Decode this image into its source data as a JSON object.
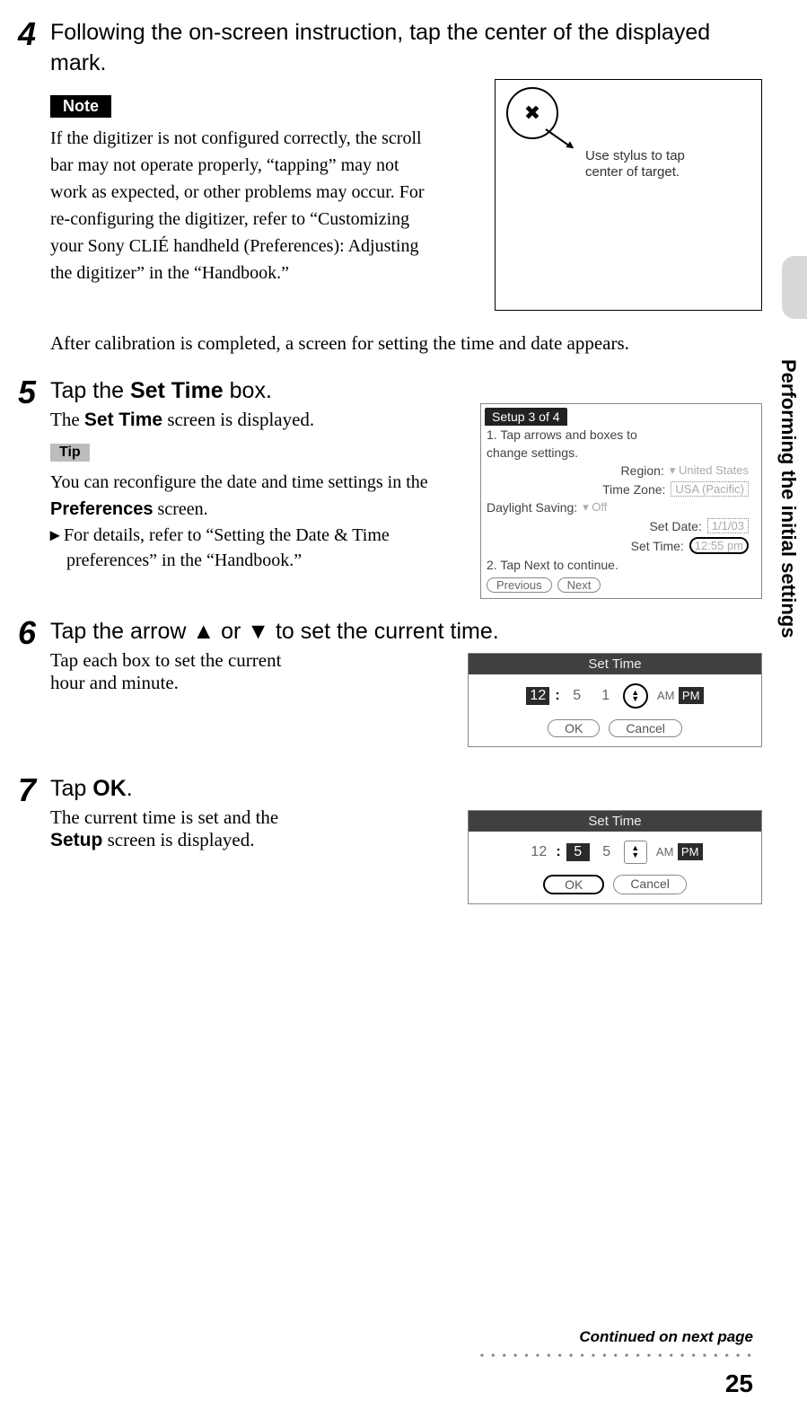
{
  "side_tab_text": "Performing the initial settings",
  "page_number": "25",
  "continued": "Continued on next page",
  "dots_line": "• • • • • • • • • • • • • • • • • • • • • • • • •",
  "step4": {
    "number": "4",
    "title": "Following the on-screen instruction, tap the center of the displayed mark.",
    "note_badge": "Note",
    "note_text": "If the digitizer is not configured correctly, the scroll bar may not operate properly, “tapping” may not work as expected, or other problems may occur. For re-configuring the digitizer, refer to “Customizing your Sony CLIÉ handheld (Preferences): Adjusting the digitizer” in the “Handbook.”",
    "fig_line1": "Use stylus to tap",
    "fig_line2": "center of target.",
    "after_text": "After calibration is completed, a screen for setting the time and date appears."
  },
  "step5": {
    "number": "5",
    "title_pre": "Tap the ",
    "title_bold": "Set Time",
    "title_post": " box.",
    "sub_pre": "The ",
    "sub_bold": "Set Time",
    "sub_post": " screen is displayed.",
    "tip_badge": "Tip",
    "tip_pre": "You can reconfigure the date and time settings in the ",
    "tip_bold": "Preferences",
    "tip_post": " screen.",
    "tip_detail": "For details, refer to “Setting the Date & Time preferences” in the “Handbook.”",
    "fig": {
      "tab": "Setup   3 of 4",
      "line1": "1. Tap arrows and boxes to",
      "line1b": "change settings.",
      "region_lbl": "Region:",
      "region_val": "▾ United States",
      "tz_lbl": "Time Zone:",
      "tz_val": "USA (Pacific)",
      "dst_lbl": "Daylight Saving:",
      "dst_val": "▾ Off",
      "date_lbl": "Set Date:",
      "date_val": "1/1/03",
      "time_lbl": "Set Time:",
      "time_val": "12:55 pm",
      "line2": "2. Tap Next to continue.",
      "btn_prev": "Previous",
      "btn_next": "Next"
    }
  },
  "step6": {
    "number": "6",
    "title": "Tap the arrow ▲ or ▼ to set the current time.",
    "sub_line1": "Tap each box to set the current",
    "sub_line2": "hour and minute.",
    "fig": {
      "title": "Set Time",
      "h": "12",
      "m1": "5",
      "m2": "1",
      "am": "AM",
      "pm": "PM",
      "ok": "OK",
      "cancel": "Cancel"
    }
  },
  "step7": {
    "number": "7",
    "title_pre": "Tap ",
    "title_bold": "OK",
    "title_post": ".",
    "sub_line1": "The current time is set and the",
    "sub_bold": "Setup",
    "sub_line2": " screen is displayed.",
    "fig": {
      "title": "Set Time",
      "h": "12",
      "m1": "5",
      "m2": "5",
      "am": "AM",
      "pm": "PM",
      "ok": "OK",
      "cancel": "Cancel"
    }
  }
}
